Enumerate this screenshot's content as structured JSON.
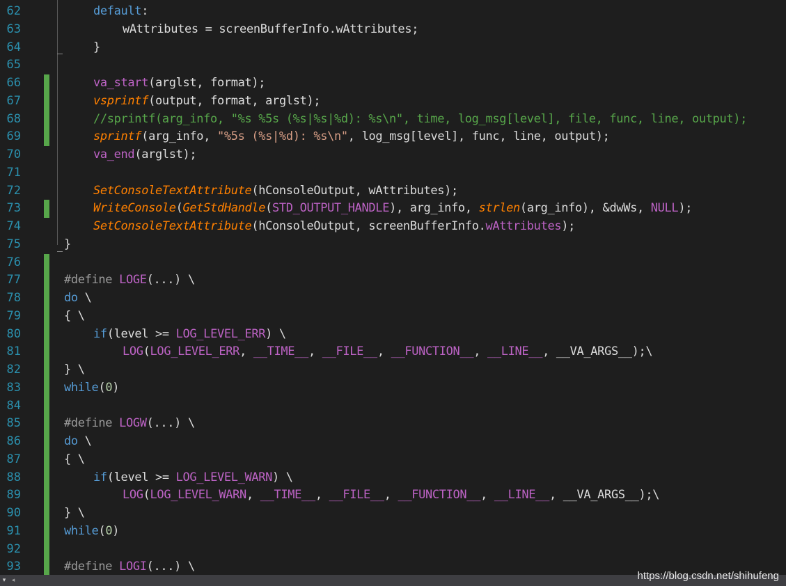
{
  "editor": {
    "lines": [
      {
        "n": "62",
        "chg": false,
        "indent": 1,
        "t": [
          [
            "kw",
            "default"
          ],
          [
            "tx",
            ":"
          ]
        ]
      },
      {
        "n": "63",
        "chg": false,
        "indent": 2,
        "t": [
          [
            "id",
            "wAttributes "
          ],
          [
            "tx",
            "= "
          ],
          [
            "id",
            "screenBufferInfo"
          ],
          [
            "tx",
            "."
          ],
          [
            "mem",
            "wAttributes"
          ],
          [
            "tx",
            ";"
          ]
        ]
      },
      {
        "n": "64",
        "chg": false,
        "indent": 1,
        "t": [
          [
            "tx",
            "}"
          ]
        ]
      },
      {
        "n": "65",
        "chg": false,
        "indent": 0,
        "t": []
      },
      {
        "n": "66",
        "chg": true,
        "indent": 1,
        "t": [
          [
            "mac",
            "va_start"
          ],
          [
            "tx",
            "("
          ],
          [
            "id",
            "arglst"
          ],
          [
            "tx",
            ", "
          ],
          [
            "id",
            "format"
          ],
          [
            "tx",
            ");"
          ]
        ]
      },
      {
        "n": "67",
        "chg": true,
        "indent": 1,
        "t": [
          [
            "fn",
            "vsprintf"
          ],
          [
            "tx",
            "("
          ],
          [
            "id",
            "output"
          ],
          [
            "tx",
            ", "
          ],
          [
            "id",
            "format"
          ],
          [
            "tx",
            ", "
          ],
          [
            "id",
            "arglst"
          ],
          [
            "tx",
            ");"
          ]
        ]
      },
      {
        "n": "68",
        "chg": true,
        "indent": 1,
        "t": [
          [
            "cm",
            "//sprintf(arg_info, \"%s %5s (%s|%s|%d): %s\\n\", time, log_msg[level], file, func, line, output);"
          ]
        ]
      },
      {
        "n": "69",
        "chg": true,
        "indent": 1,
        "t": [
          [
            "fn",
            "sprintf"
          ],
          [
            "tx",
            "("
          ],
          [
            "id",
            "arg_info"
          ],
          [
            "tx",
            ", "
          ],
          [
            "str",
            "\"%5s (%s|%d): %s\\n\""
          ],
          [
            "tx",
            ", "
          ],
          [
            "id",
            "log_msg"
          ],
          [
            "tx",
            "["
          ],
          [
            "id",
            "level"
          ],
          [
            "tx",
            "], "
          ],
          [
            "id",
            "func"
          ],
          [
            "tx",
            ", "
          ],
          [
            "id",
            "line"
          ],
          [
            "tx",
            ", "
          ],
          [
            "id",
            "output"
          ],
          [
            "tx",
            ");"
          ]
        ]
      },
      {
        "n": "70",
        "chg": false,
        "indent": 1,
        "t": [
          [
            "mac",
            "va_end"
          ],
          [
            "tx",
            "("
          ],
          [
            "id",
            "arglst"
          ],
          [
            "tx",
            ");"
          ]
        ]
      },
      {
        "n": "71",
        "chg": false,
        "indent": 0,
        "t": []
      },
      {
        "n": "72",
        "chg": false,
        "indent": 1,
        "t": [
          [
            "fn",
            "SetConsoleTextAttribute"
          ],
          [
            "tx",
            "("
          ],
          [
            "id",
            "hConsoleOutput"
          ],
          [
            "tx",
            ", "
          ],
          [
            "id",
            "wAttributes"
          ],
          [
            "tx",
            ");"
          ]
        ]
      },
      {
        "n": "73",
        "chg": true,
        "indent": 1,
        "t": [
          [
            "fn",
            "WriteConsole"
          ],
          [
            "tx",
            "("
          ],
          [
            "fn",
            "GetStdHandle"
          ],
          [
            "tx",
            "("
          ],
          [
            "mac",
            "STD_OUTPUT_HANDLE"
          ],
          [
            "tx",
            "), "
          ],
          [
            "id",
            "arg_info"
          ],
          [
            "tx",
            ", "
          ],
          [
            "fn",
            "strlen"
          ],
          [
            "tx",
            "("
          ],
          [
            "id",
            "arg_info"
          ],
          [
            "tx",
            "), &"
          ],
          [
            "id",
            "dwWs"
          ],
          [
            "tx",
            ", "
          ],
          [
            "mac",
            "NULL"
          ],
          [
            "tx",
            ");"
          ]
        ]
      },
      {
        "n": "74",
        "chg": false,
        "indent": 1,
        "t": [
          [
            "fn",
            "SetConsoleTextAttribute"
          ],
          [
            "tx",
            "("
          ],
          [
            "id",
            "hConsoleOutput"
          ],
          [
            "tx",
            ", "
          ],
          [
            "id",
            "screenBufferInfo"
          ],
          [
            "tx",
            "."
          ],
          [
            "mac",
            "wAttributes"
          ],
          [
            "tx",
            ");"
          ]
        ]
      },
      {
        "n": "75",
        "chg": false,
        "indent": 0,
        "t": [
          [
            "tx",
            "}"
          ]
        ]
      },
      {
        "n": "76",
        "chg": true,
        "indent": 0,
        "t": []
      },
      {
        "n": "77",
        "chg": true,
        "indent": 0,
        "t": [
          [
            "pp",
            "#define "
          ],
          [
            "mac",
            "LOGE"
          ],
          [
            "tx",
            "(...) \\"
          ]
        ]
      },
      {
        "n": "78",
        "chg": true,
        "indent": 0,
        "t": [
          [
            "kw",
            "do"
          ],
          [
            "tx",
            " \\"
          ]
        ]
      },
      {
        "n": "79",
        "chg": true,
        "indent": 0,
        "t": [
          [
            "tx",
            "{ \\"
          ]
        ]
      },
      {
        "n": "80",
        "chg": true,
        "indent": 1,
        "t": [
          [
            "kw",
            "if"
          ],
          [
            "tx",
            "("
          ],
          [
            "id",
            "level "
          ],
          [
            "tx",
            ">= "
          ],
          [
            "mac",
            "LOG_LEVEL_ERR"
          ],
          [
            "tx",
            ") \\"
          ]
        ]
      },
      {
        "n": "81",
        "chg": true,
        "indent": 2,
        "t": [
          [
            "mac",
            "LOG"
          ],
          [
            "tx",
            "("
          ],
          [
            "mac",
            "LOG_LEVEL_ERR"
          ],
          [
            "tx",
            ", "
          ],
          [
            "mac",
            "__TIME__"
          ],
          [
            "tx",
            ", "
          ],
          [
            "mac",
            "__FILE__"
          ],
          [
            "tx",
            ", "
          ],
          [
            "mac",
            "__FUNCTION__"
          ],
          [
            "tx",
            ", "
          ],
          [
            "mac",
            "__LINE__"
          ],
          [
            "tx",
            ", "
          ],
          [
            "id",
            "__VA_ARGS__"
          ],
          [
            "tx",
            ");\\"
          ]
        ]
      },
      {
        "n": "82",
        "chg": true,
        "indent": 0,
        "t": [
          [
            "tx",
            "} \\"
          ]
        ]
      },
      {
        "n": "83",
        "chg": true,
        "indent": 0,
        "t": [
          [
            "kw",
            "while"
          ],
          [
            "tx",
            "("
          ],
          [
            "num",
            "0"
          ],
          [
            "tx",
            ")"
          ]
        ]
      },
      {
        "n": "84",
        "chg": true,
        "indent": 0,
        "t": []
      },
      {
        "n": "85",
        "chg": true,
        "indent": 0,
        "t": [
          [
            "pp",
            "#define "
          ],
          [
            "mac",
            "LOGW"
          ],
          [
            "tx",
            "(...) \\"
          ]
        ]
      },
      {
        "n": "86",
        "chg": true,
        "indent": 0,
        "t": [
          [
            "kw",
            "do"
          ],
          [
            "tx",
            " \\"
          ]
        ]
      },
      {
        "n": "87",
        "chg": true,
        "indent": 0,
        "t": [
          [
            "tx",
            "{ \\"
          ]
        ]
      },
      {
        "n": "88",
        "chg": true,
        "indent": 1,
        "t": [
          [
            "kw",
            "if"
          ],
          [
            "tx",
            "("
          ],
          [
            "id",
            "level "
          ],
          [
            "tx",
            ">= "
          ],
          [
            "mac",
            "LOG_LEVEL_WARN"
          ],
          [
            "tx",
            ") \\"
          ]
        ]
      },
      {
        "n": "89",
        "chg": true,
        "indent": 2,
        "t": [
          [
            "mac",
            "LOG"
          ],
          [
            "tx",
            "("
          ],
          [
            "mac",
            "LOG_LEVEL_WARN"
          ],
          [
            "tx",
            ", "
          ],
          [
            "mac",
            "__TIME__"
          ],
          [
            "tx",
            ", "
          ],
          [
            "mac",
            "__FILE__"
          ],
          [
            "tx",
            ", "
          ],
          [
            "mac",
            "__FUNCTION__"
          ],
          [
            "tx",
            ", "
          ],
          [
            "mac",
            "__LINE__"
          ],
          [
            "tx",
            ", "
          ],
          [
            "id",
            "__VA_ARGS__"
          ],
          [
            "tx",
            ");\\"
          ]
        ]
      },
      {
        "n": "90",
        "chg": true,
        "indent": 0,
        "t": [
          [
            "tx",
            "} \\"
          ]
        ]
      },
      {
        "n": "91",
        "chg": true,
        "indent": 0,
        "t": [
          [
            "kw",
            "while"
          ],
          [
            "tx",
            "("
          ],
          [
            "num",
            "0"
          ],
          [
            "tx",
            ")"
          ]
        ]
      },
      {
        "n": "92",
        "chg": true,
        "indent": 0,
        "t": []
      },
      {
        "n": "93",
        "chg": true,
        "indent": 0,
        "t": [
          [
            "pp",
            "#define "
          ],
          [
            "mac",
            "LOGI"
          ],
          [
            "tx",
            "(...) \\"
          ]
        ]
      }
    ]
  },
  "status": {
    "scroll_button": "▾",
    "scroll_left": "◂"
  },
  "watermark": "https://blog.csdn.net/shihufeng",
  "colors": {
    "background": "#1e1e1e",
    "line_numbers": "#2b91af",
    "change_marker": "#57a64a",
    "keyword": "#569cd6",
    "function": "#ff8000",
    "macro": "#bd63c5",
    "comment": "#57a64a"
  }
}
